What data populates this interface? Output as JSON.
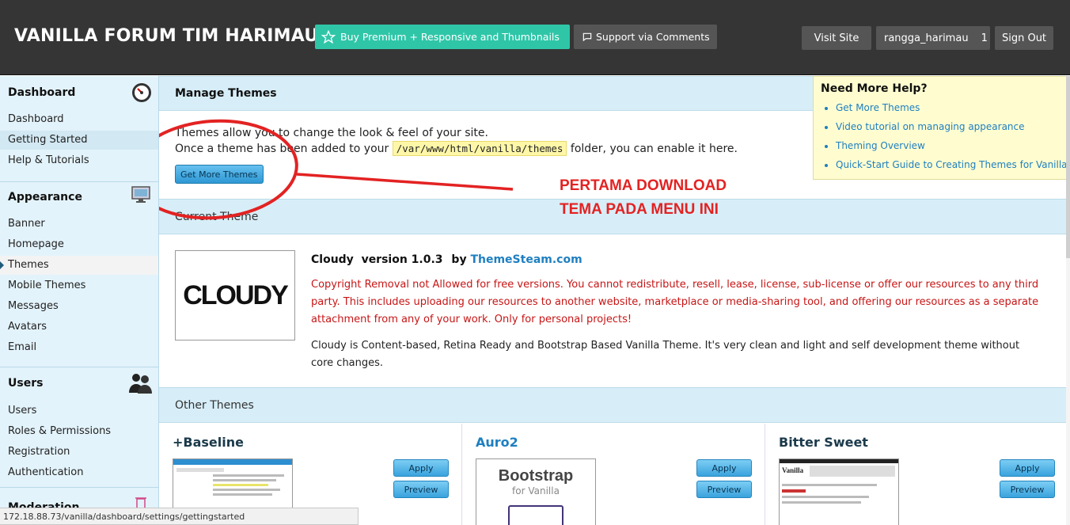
{
  "header": {
    "site_title": "VANILLA FORUM TIM HARIMAU",
    "premium_label": "Buy Premium + Responsive and Thumbnails",
    "support_label": "Support via Comments",
    "visit_site": "Visit Site",
    "username": "rangga_harimau",
    "notification_count": "1",
    "sign_out": "Sign Out"
  },
  "sidebar": {
    "dashboard": {
      "title": "Dashboard",
      "items": [
        "Dashboard",
        "Getting Started",
        "Help & Tutorials"
      ]
    },
    "appearance": {
      "title": "Appearance",
      "items": [
        "Banner",
        "Homepage",
        "Themes",
        "Mobile Themes",
        "Messages",
        "Avatars",
        "Email"
      ]
    },
    "users": {
      "title": "Users",
      "items": [
        "Users",
        "Roles & Permissions",
        "Registration",
        "Authentication"
      ]
    },
    "moderation": {
      "title": "Moderation"
    }
  },
  "main": {
    "manage_title": "Manage Themes",
    "intro_line1": "Themes allow you to change the look & feel of your site.",
    "intro_line2_pre": "Once a theme has been added to your",
    "intro_path": "/var/www/html/vanilla/themes",
    "intro_line2_post": "folder, you can enable it here.",
    "get_more_button": "Get More Themes",
    "current_theme_title": "Current Theme",
    "current_theme": {
      "name": "Cloudy",
      "version": "version 1.0.3",
      "by": "by",
      "author": "ThemeSteam.com",
      "thumb_text": "CLOUDY",
      "warning": "Copyright Removal not Allowed for free versions. You cannot redistribute, resell, lease, license, sub-license or offer our resources to any third party. This includes uploading our resources to another website, marketplace or media-sharing tool, and offering our resources as a separate attachment from any of your work. Only for personal projects!",
      "description": "Cloudy is Content-based, Retina Ready and Bootstrap Based Vanilla Theme. It's very clean and light and self development theme without core changes."
    },
    "other_themes_title": "Other Themes",
    "other_themes": [
      {
        "name": "+Baseline",
        "apply": "Apply",
        "preview": "Preview"
      },
      {
        "name": "Auro2",
        "apply": "Apply",
        "preview": "Preview",
        "thumb_title": "Bootstrap",
        "thumb_sub": "for Vanilla"
      },
      {
        "name": "Bitter Sweet",
        "apply": "Apply",
        "preview": "Preview",
        "thumb_brand": "Vanilla"
      }
    ]
  },
  "help": {
    "title": "Need More Help?",
    "links": [
      "Get More Themes",
      "Video tutorial on managing appearance",
      "Theming Overview",
      "Quick-Start Guide to Creating Themes for Vanilla"
    ]
  },
  "annotation": {
    "line1": "PERTAMA DOWNLOAD",
    "line2": "TEMA PADA MENU INI",
    "color": "#e32222"
  },
  "status_bar": {
    "url": "172.18.88.73/vanilla/dashboard/settings/gettingstarted"
  },
  "colors": {
    "header_bg": "#353535",
    "premium_bg": "#2fc6a8",
    "sidebar_bg": "#e3f3fb",
    "section_bar_bg": "#d7eef8",
    "link": "#1e7fc0",
    "warning": "#c71515"
  }
}
